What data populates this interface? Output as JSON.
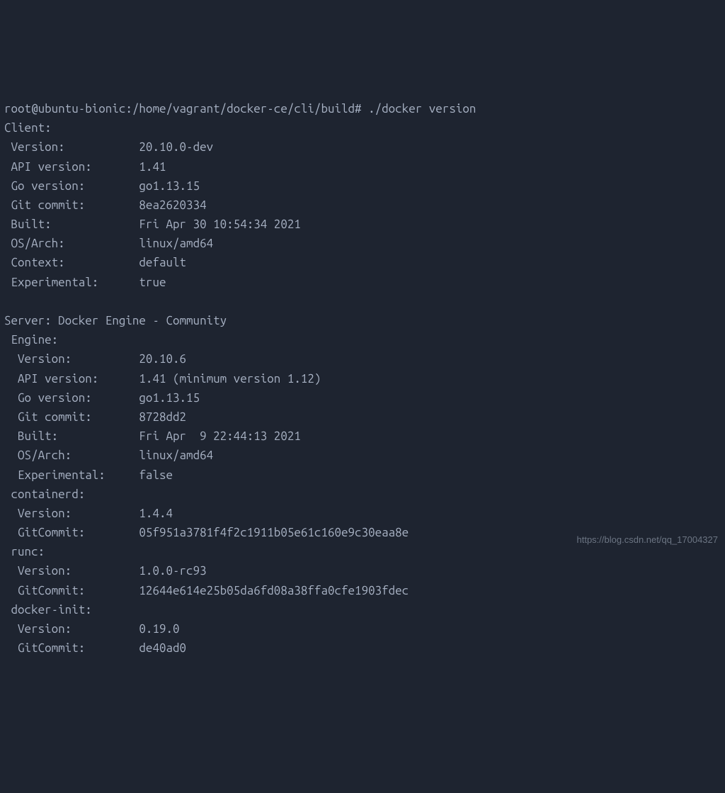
{
  "prompt": "root@ubuntu-bionic:/home/vagrant/docker-ce/cli/build# ./docker version",
  "client_header": "Client:",
  "client": {
    "version_k": " Version:           ",
    "version_v": "20.10.0-dev",
    "api_k": " API version:       ",
    "api_v": "1.41",
    "go_k": " Go version:        ",
    "go_v": "go1.13.15",
    "git_k": " Git commit:        ",
    "git_v": "8ea2620334",
    "built_k": " Built:             ",
    "built_v": "Fri Apr 30 10:54:34 2021",
    "os_k": " OS/Arch:           ",
    "os_v": "linux/amd64",
    "ctx_k": " Context:           ",
    "ctx_v": "default",
    "exp_k": " Experimental:      ",
    "exp_v": "true"
  },
  "server_header": "Server: Docker Engine - Community",
  "engine_header": " Engine:",
  "engine": {
    "version_k": "  Version:          ",
    "version_v": "20.10.6",
    "api_k": "  API version:      ",
    "api_v": "1.41 (minimum version 1.12)",
    "go_k": "  Go version:       ",
    "go_v": "go1.13.15",
    "git_k": "  Git commit:       ",
    "git_v": "8728dd2",
    "built_k": "  Built:            ",
    "built_v": "Fri Apr  9 22:44:13 2021",
    "os_k": "  OS/Arch:          ",
    "os_v": "linux/amd64",
    "exp_k": "  Experimental:     ",
    "exp_v": "false"
  },
  "containerd_header": " containerd:",
  "containerd": {
    "version_k": "  Version:          ",
    "version_v": "1.4.4",
    "git_k": "  GitCommit:        ",
    "git_v": "05f951a3781f4f2c1911b05e61c160e9c30eaa8e"
  },
  "runc_header": " runc:",
  "runc": {
    "version_k": "  Version:          ",
    "version_v": "1.0.0-rc93",
    "git_k": "  GitCommit:        ",
    "git_v": "12644e614e25b05da6fd08a38ffa0cfe1903fdec"
  },
  "dinit_header": " docker-init:",
  "dinit": {
    "version_k": "  Version:          ",
    "version_v": "0.19.0",
    "git_k": "  GitCommit:        ",
    "git_v": "de40ad0"
  },
  "watermark": "https://blog.csdn.net/qq_17004327"
}
